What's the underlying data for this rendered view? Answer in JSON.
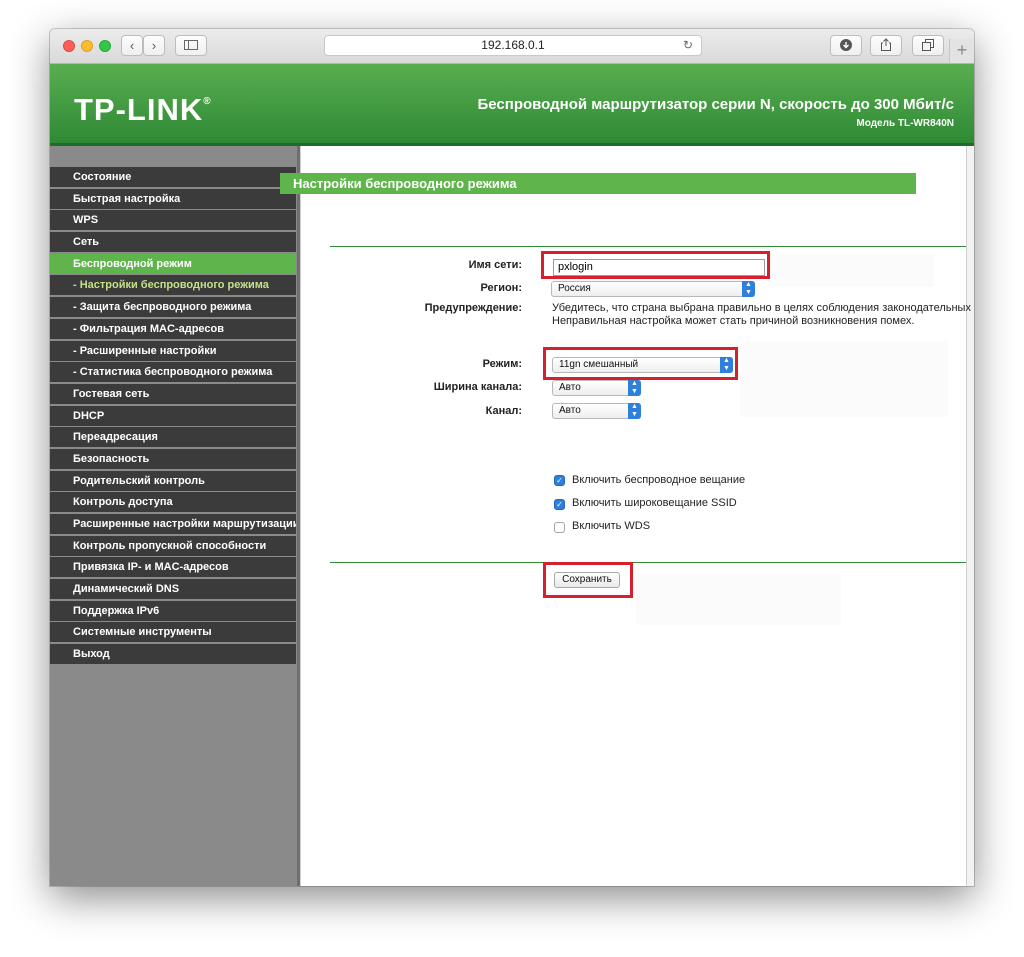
{
  "browser": {
    "url": "192.168.0.1",
    "back_glyph": "‹",
    "forward_glyph": "›",
    "reload_glyph": "↻",
    "new_tab_glyph": "+"
  },
  "header": {
    "logo": "TP-LINK",
    "logo_mark": "®",
    "title": "Беспроводной маршрутизатор серии N, скорость до 300 Мбит/с",
    "model": "Модель TL-WR840N"
  },
  "sidebar": {
    "items": [
      {
        "label": "Состояние",
        "kind": "main"
      },
      {
        "label": "Быстрая настройка",
        "kind": "main"
      },
      {
        "label": "WPS",
        "kind": "main"
      },
      {
        "label": "Сеть",
        "kind": "main"
      },
      {
        "label": "Беспроводной режим",
        "kind": "active"
      },
      {
        "label": "- Настройки беспроводного режима",
        "kind": "current"
      },
      {
        "label": "- Защита беспроводного режима",
        "kind": "sub"
      },
      {
        "label": "- Фильтрация MAC-адресов",
        "kind": "sub"
      },
      {
        "label": "- Расширенные настройки",
        "kind": "sub"
      },
      {
        "label": "- Статистика беспроводного режима",
        "kind": "sub"
      },
      {
        "label": "Гостевая сеть",
        "kind": "main"
      },
      {
        "label": "DHCP",
        "kind": "main"
      },
      {
        "label": "Переадресация",
        "kind": "main"
      },
      {
        "label": "Безопасность",
        "kind": "main"
      },
      {
        "label": "Родительский контроль",
        "kind": "main"
      },
      {
        "label": "Контроль доступа",
        "kind": "main"
      },
      {
        "label": "Расширенные настройки маршрутизации",
        "kind": "main"
      },
      {
        "label": "Контроль пропускной способности",
        "kind": "main"
      },
      {
        "label": "Привязка IP- и MAC-адресов",
        "kind": "main"
      },
      {
        "label": "Динамический DNS",
        "kind": "main"
      },
      {
        "label": "Поддержка IPv6",
        "kind": "main"
      },
      {
        "label": "Системные инструменты",
        "kind": "main"
      },
      {
        "label": "Выход",
        "kind": "main"
      }
    ]
  },
  "form": {
    "section_title": "Настройки беспроводного режима",
    "ssid_label": "Имя сети:",
    "ssid_value": "pxlogin",
    "region_label": "Регион:",
    "region_value": "Россия",
    "warning_label": "Предупреждение:",
    "warning_line1": "Убедитесь, что страна выбрана правильно в целях соблюдения законодательных",
    "warning_line2": "Неправильная настройка может стать причиной возникновения помех.",
    "mode_label": "Режим:",
    "mode_value": "11gn смешанный",
    "width_label": "Ширина канала:",
    "width_value": "Авто",
    "channel_label": "Канал:",
    "channel_value": "Авто",
    "checkboxes": [
      {
        "label": "Включить беспроводное вещание",
        "checked": true
      },
      {
        "label": "Включить широковещание SSID",
        "checked": true
      },
      {
        "label": "Включить WDS",
        "checked": false
      }
    ],
    "save_label": "Сохранить"
  },
  "colors": {
    "brand_green": "#5fb54b",
    "highlight_red": "#d6202d",
    "menu_dark": "#3b3b3b"
  }
}
